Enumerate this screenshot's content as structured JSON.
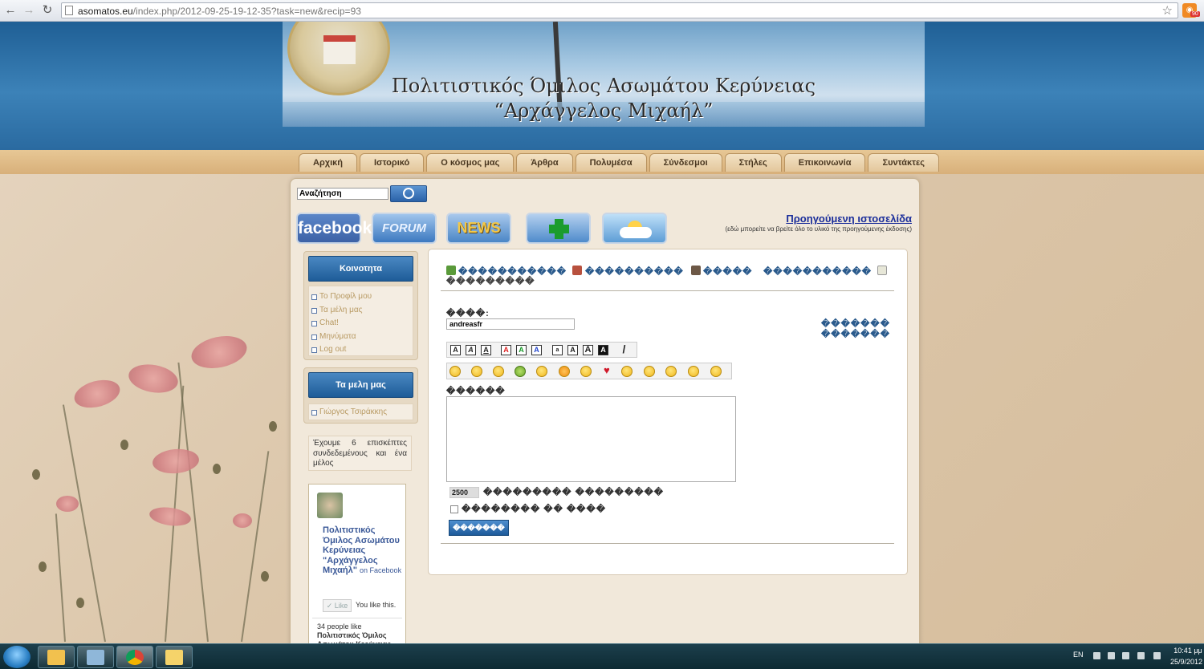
{
  "browser": {
    "url_host": "asomatos.eu",
    "url_path": "/index.php/2012-09-25-19-12-35?task=new&recip=93",
    "rss_badge": "90"
  },
  "header": {
    "title_line1": "Πολιτιστικός Όμιλος Ασωμάτου Κερύνειας",
    "title_line2": "“Αρχάγγελος Μιχαήλ”"
  },
  "nav": {
    "items": [
      "Αρχική",
      "Ιστορικό",
      "Ο κόσμος μας",
      "Άρθρα",
      "Πολυμέσα",
      "Σύνδεσμοι",
      "Στήλες",
      "Επικοινωνία",
      "Συντάκτες"
    ]
  },
  "search": {
    "value": "Αναζήτηση"
  },
  "social": {
    "facebook": "facebook",
    "forum": "FORUM",
    "news": "NEWS"
  },
  "prev_site": {
    "link": "Προηγούμενη ιστοσελίδα",
    "note": "(εδώ μπορείτε να βρείτε όλο το υλικό της προηγούμενης έκδοσης)"
  },
  "sidebar": {
    "community_title": "Κοινοτητα",
    "community_items": [
      "Το Προφίλ μου",
      "Τα μέλη μας",
      "Chat!",
      "Μηνύματα",
      "Log out"
    ],
    "members_title": "Τα μελη μας",
    "members_items": [
      "Γιώργος Τσιράκκης"
    ],
    "visitors_text": "Έχουμε 6 επισκέπτες συνδεδεμένους και ένα μέλος",
    "fb_page_name": "Πολιτιστικός Όμιλος Ασωμάτου Κερύνειας \"Αρχάγγελος Μιχαήλ\"",
    "fb_on": "on Facebook",
    "fb_like": "Like",
    "fb_you_like": "You like this.",
    "fb_count": "34 people like",
    "fb_page_name_short": "Πολιτιστικός Όμιλος Ασωμάτου Κερύνειας"
  },
  "content": {
    "tab1": "�����������",
    "tab2": "����������",
    "tab3": "�����",
    "tab4": "�����������",
    "tab_line2": "���������",
    "to_label": "����:",
    "to_value": "andreasfr",
    "recipients_link": "������� �������",
    "format_buttons": [
      "A",
      "A",
      "A",
      "A",
      "A",
      "A",
      "a",
      "A",
      "A",
      "A",
      "/"
    ],
    "message_label": "������",
    "char_count": "2500",
    "char_label": "��������� ���������",
    "save_label": "�������� �� ����",
    "send_label": "�������"
  },
  "taskbar": {
    "lang": "EN",
    "time": "10:41 μμ",
    "date": "25/9/2012"
  }
}
